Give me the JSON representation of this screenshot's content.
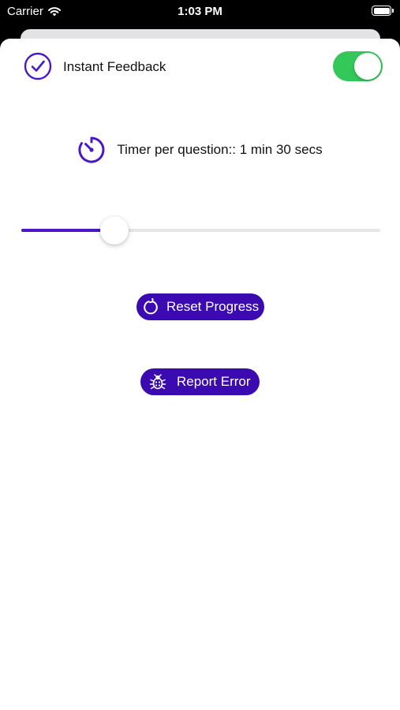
{
  "status_bar": {
    "carrier": "Carrier",
    "time": "1:03 PM"
  },
  "settings": {
    "instant_feedback": {
      "label": "Instant Feedback",
      "enabled": true,
      "icon": "checkmark-circle-icon"
    },
    "timer": {
      "label": "Timer per question:: 1 min 30 secs",
      "icon": "timer-icon",
      "slider_value_fraction": 0.15
    },
    "reset_button": {
      "label": "Reset Progress",
      "icon": "refresh-icon"
    },
    "report_button": {
      "label": "Report Error",
      "icon": "bug-icon"
    }
  },
  "colors": {
    "accent": "#3b0ab0",
    "icon_purple": "#4a18c8",
    "toggle_on": "#34c759",
    "track": "#e5e5ea"
  }
}
